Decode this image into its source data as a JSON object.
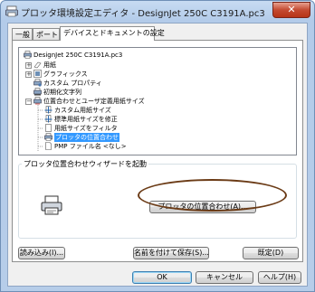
{
  "window": {
    "title": "プロッタ環境設定エディタ - DesignJet 250C C3191A.pc3"
  },
  "tabs": [
    {
      "label": "一般"
    },
    {
      "label": "ポート"
    },
    {
      "label": "デバイスとドキュメントの設定"
    }
  ],
  "tree": {
    "root": "DesignJet 250C C3191A.pc3",
    "items": [
      {
        "label": "用紙"
      },
      {
        "label": "グラフィックス"
      },
      {
        "label": "カスタム プロパティ"
      },
      {
        "label": "初期化文字列"
      },
      {
        "label": "位置合わせとユーザ定義用紙サイズ"
      },
      {
        "label": "カスタム用紙サイズ"
      },
      {
        "label": "標準用紙サイズを修正"
      },
      {
        "label": "用紙サイズをフィルタ"
      },
      {
        "label": "プロッタの位置合わせ"
      },
      {
        "label": "PMP ファイル名 <なし>"
      }
    ]
  },
  "group": {
    "label": "プロッタ位置合わせウィザードを起動",
    "button": "プロッタの位置合わせ(A)..."
  },
  "buttons": {
    "import": "読み込み(I)...",
    "save_as": "名前を付けて保存(S)...",
    "defaults": "既定(D)",
    "ok": "OK",
    "cancel": "キャンセル",
    "help": "ヘルプ(H)"
  },
  "colors": {
    "selection": "#3399ff",
    "annotation_oval": "#6b3b16",
    "close_button": "#c44a31"
  }
}
